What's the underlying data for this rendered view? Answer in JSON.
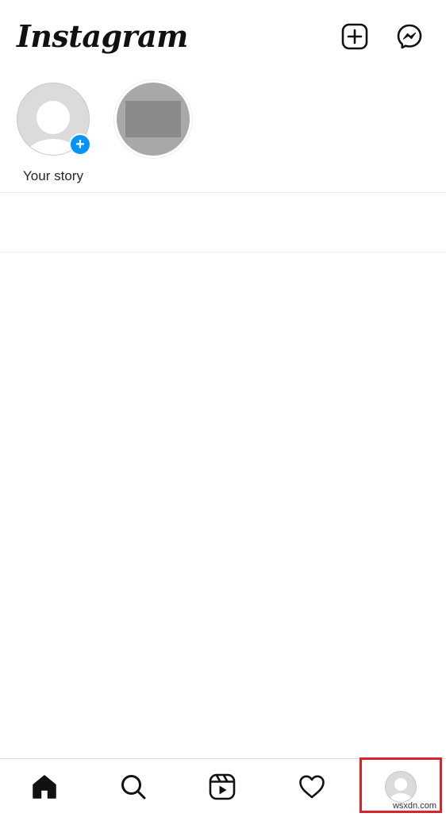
{
  "header": {
    "logo_text": "Instagram",
    "new_post_icon": "plus-square-icon",
    "messenger_icon": "messenger-icon"
  },
  "stories": {
    "items": [
      {
        "label": "Your story",
        "type": "own",
        "badge": "+"
      },
      {
        "label": "",
        "type": "other"
      }
    ]
  },
  "bottom_nav": {
    "items": [
      {
        "icon": "home-icon"
      },
      {
        "icon": "search-icon"
      },
      {
        "icon": "reels-icon"
      },
      {
        "icon": "heart-icon"
      },
      {
        "icon": "profile-avatar-icon"
      }
    ],
    "highlighted": "profile"
  },
  "colors": {
    "accent": "#0095f6",
    "highlight": "#d6262b",
    "text": "#262626"
  },
  "watermark": "wsxdn.com"
}
